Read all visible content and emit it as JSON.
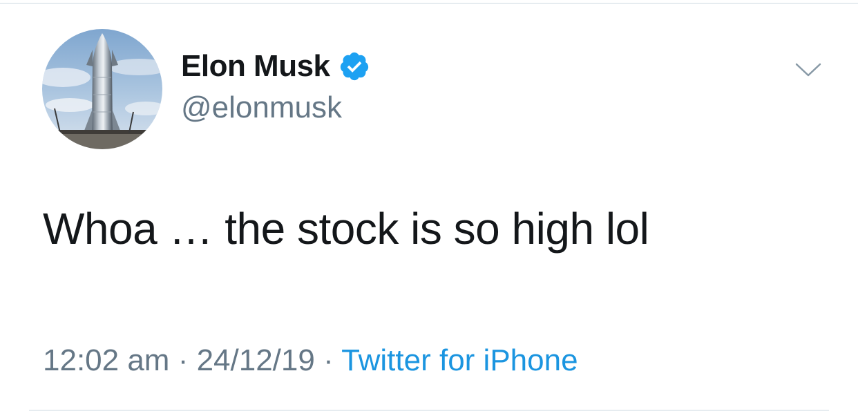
{
  "author": {
    "display_name": "Elon Musk",
    "handle": "@elonmusk",
    "verified": true,
    "avatar_icon": "starship-prototype-avatar"
  },
  "tweet": {
    "text": "Whoa … the stock is so high lol"
  },
  "meta": {
    "time": "12:02 am",
    "separator_1": " · ",
    "date": "24/12/19",
    "separator_2": " · ",
    "source": "Twitter for iPhone"
  },
  "menu": {
    "icon": "chevron-down-icon"
  },
  "colors": {
    "text_primary": "#14171a",
    "text_secondary": "#657786",
    "link": "#1b95e0",
    "verified": "#1da1f2",
    "divider": "#e6ecf0"
  }
}
